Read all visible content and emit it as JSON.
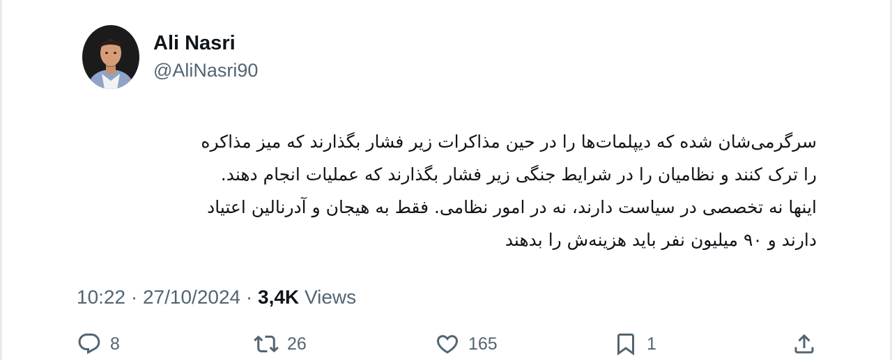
{
  "author": {
    "display_name": "Ali Nasri",
    "handle": "@AliNasri90"
  },
  "tweet": {
    "lines": [
      "سرگرمی‌شان شده که دیپلمات‌ها را در حین مذاکرات زیر فشار بگذارند که میز مذاکره",
      "را ترک کنند و نظامیان را در شرایط جنگی زیر فشار بگذارند که عملیات انجام دهند.",
      "اینها نه تخصصی در سیاست دارند، نه در امور نظامی. فقط به هیجان و آدرنالین اعتیاد",
      "دارند و ۹۰ میلیون نفر باید هزینه‌ش را بدهند"
    ],
    "time": "10:22",
    "separator": "·",
    "date": "27/10/2024",
    "views_count": "3,4K",
    "views_label": "Views"
  },
  "actions": {
    "reply": {
      "icon": "reply-icon",
      "count": "8"
    },
    "retweet": {
      "icon": "retweet-icon",
      "count": "26"
    },
    "like": {
      "icon": "heart-icon",
      "count": "165"
    },
    "bookmark": {
      "icon": "bookmark-icon",
      "count": "1"
    },
    "share": {
      "icon": "share-icon"
    }
  },
  "colors": {
    "text_primary": "#0f1419",
    "text_secondary": "#536471",
    "background": "#ffffff"
  }
}
